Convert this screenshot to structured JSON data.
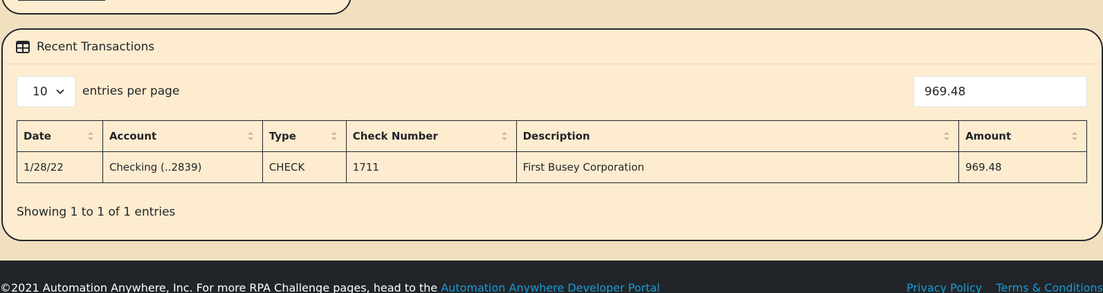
{
  "card": {
    "title": "Recent Transactions",
    "entries_select": "10",
    "entries_label": "entries per page",
    "search_value": "969.48",
    "columns": [
      "Date",
      "Account",
      "Type",
      "Check Number",
      "Description",
      "Amount"
    ],
    "rows": [
      [
        "1/28/22",
        "Checking (..2839)",
        "CHECK",
        "1711",
        "First Busey Corporation",
        "969.48"
      ]
    ],
    "info": "Showing 1 to 1 of 1 entries"
  },
  "footer": {
    "text": "©2021 Automation Anywhere, Inc. For more RPA Challenge pages, head to the ",
    "link": "Automation Anywhere Developer Portal",
    "privacy": "Privacy Policy",
    "terms": "Terms & Conditions"
  },
  "colors": {
    "page_bg": "#f0e0c0",
    "card_bg": "#fdeccf",
    "footer_bg": "#212529",
    "link": "#1a9bd7"
  }
}
